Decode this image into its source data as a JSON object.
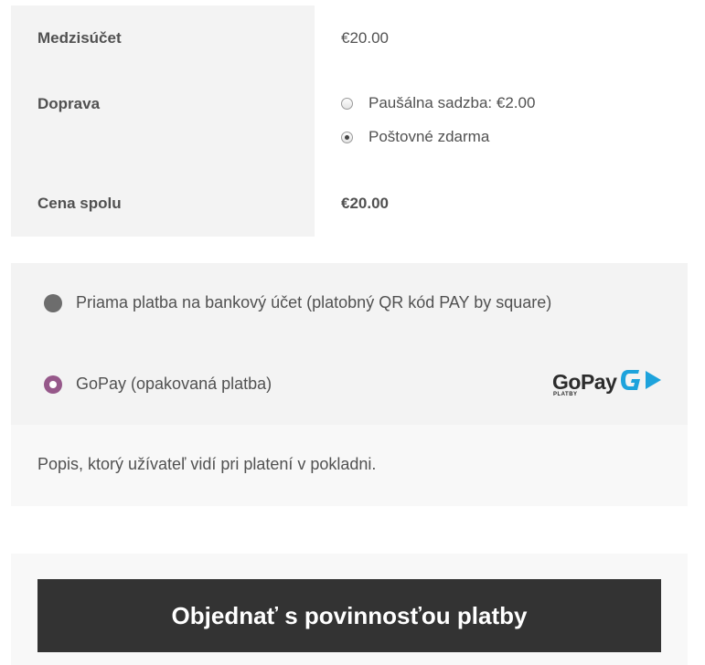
{
  "order_totals": {
    "subtotal": {
      "label": "Medzisúčet",
      "value": "€20.00"
    },
    "shipping": {
      "label": "Doprava",
      "options": [
        {
          "label": "Paušálna sadzba: €2.00",
          "selected": false
        },
        {
          "label": "Poštovné zdarma",
          "selected": true
        }
      ]
    },
    "total": {
      "label": "Cena spolu",
      "value": "€20.00"
    }
  },
  "payment": {
    "methods": [
      {
        "label": "Priama platba na bankový účet (platobný QR kód PAY by square)",
        "selected": false
      },
      {
        "label": "GoPay (opakovaná platba)",
        "selected": true,
        "logo_icon": "gopay-logo"
      }
    ],
    "gopay_logo": {
      "word": "GoPay",
      "sub": "PLATBY"
    },
    "description": "Popis, ktorý užívateľ vidí pri platení v pokladni."
  },
  "place_order": {
    "label": "Objednať s povinnosťou platby"
  },
  "colors": {
    "accent": "#96588a",
    "button_bg": "#333333",
    "gopay_blue": "#1ea3dc"
  }
}
